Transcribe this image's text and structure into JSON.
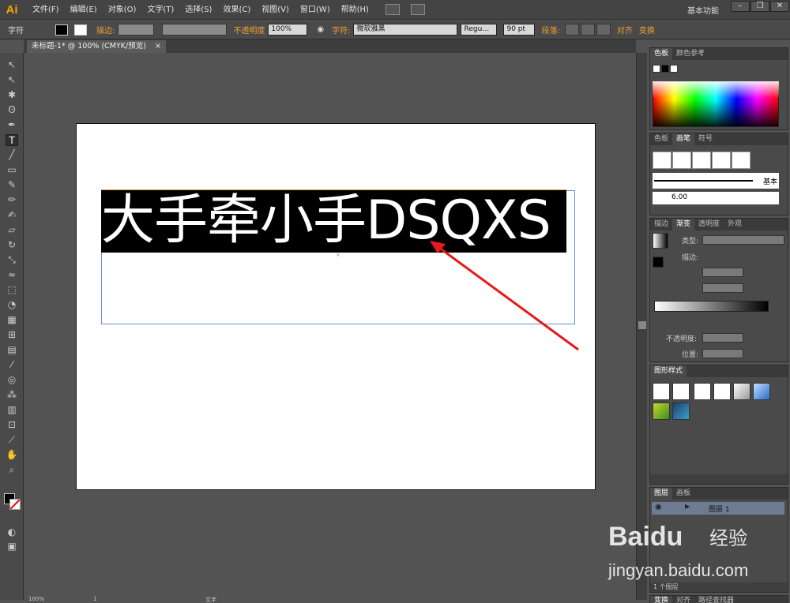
{
  "app": {
    "logo": "Ai",
    "workspace": "基本功能",
    "window_controls": [
      "–",
      "❐",
      "✕"
    ]
  },
  "menu": [
    "文件(F)",
    "编辑(E)",
    "对象(O)",
    "文字(T)",
    "选择(S)",
    "效果(C)",
    "视图(V)",
    "窗口(W)",
    "帮助(H)"
  ],
  "control_bar": {
    "tool_label": "字符",
    "stroke_label": "描边:",
    "opacity_label": "不透明度",
    "opacity_value": "100%",
    "font_label": "字符:",
    "font_value": "微软雅黑",
    "style_value": "Regu…",
    "size_value": "90 pt",
    "paragraph_label": "段落:",
    "align_label": "对齐",
    "transform_label": "变换"
  },
  "document": {
    "tab_title": "未标题-1* @ 100% (CMYK/预览)",
    "tab_close": "×",
    "headline_text": "大手牵小手DSQXS",
    "center_mark": "×"
  },
  "panels": {
    "color": {
      "tabs": [
        "色板",
        "颜色参考"
      ],
      "active_tab": "色板"
    },
    "brushes": {
      "tabs": [
        "色板",
        "画笔",
        "符号"
      ],
      "active_tab": "画笔",
      "brush_name": "基本",
      "brush_size": "6.00"
    },
    "gradient": {
      "tabs": [
        "描边",
        "渐变",
        "透明度",
        "外观"
      ],
      "active_tab": "渐变",
      "type_label": "类型:",
      "stroke_label": "描边:",
      "opacity_label": "不透明度:",
      "position_label": "位置:"
    },
    "graphic_styles": {
      "tabs": [
        "图形样式"
      ],
      "active_tab": "图形样式"
    },
    "layers": {
      "tabs": [
        "图层",
        "画板"
      ],
      "active_tab": "图层",
      "layer_name": "图层 1",
      "footer": "1 个图层"
    },
    "bottom_tabs": [
      "变换",
      "对齐",
      "路径查找器"
    ]
  },
  "status_bar": {
    "zoom": "100%",
    "page": "1",
    "status": "文字"
  },
  "watermark": {
    "brand": "Baidu",
    "product": "经验",
    "url": "jingyan.baidu.com"
  },
  "colors": {
    "accent_orange": "#f0a030",
    "frame_blue": "#6b8ddf",
    "arrow_red": "#e8191a",
    "logo_orange": "#f7a500"
  }
}
